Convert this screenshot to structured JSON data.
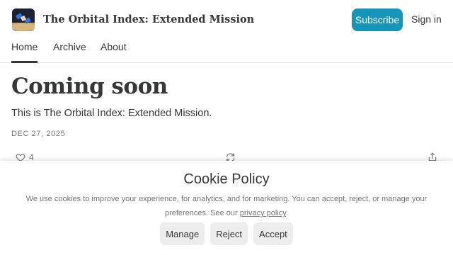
{
  "header": {
    "publication_title": "The Orbital Index: Extended Mission",
    "subscribe_label": "Subscribe",
    "signin_label": "Sign in",
    "logo_icon": "satellite-logo"
  },
  "nav": {
    "tabs": [
      {
        "label": "Home",
        "active": true
      },
      {
        "label": "Archive",
        "active": false
      },
      {
        "label": "About",
        "active": false
      }
    ]
  },
  "post": {
    "title": "Coming soon",
    "subtitle": "This is The Orbital Index: Extended Mission.",
    "date": "DEC 27, 2025",
    "like_count": "4",
    "like_icon": "heart-icon",
    "restack_icon": "restack-icon",
    "share_icon": "share-icon"
  },
  "cookie": {
    "title": "Cookie Policy",
    "text_before_link": "We use cookies to improve your experience, for analytics, and for marketing. You can accept, reject, or manage your preferences. See our ",
    "link_label": "privacy policy",
    "text_after_link": ".",
    "buttons": {
      "manage": "Manage",
      "reject": "Reject",
      "accept": "Accept"
    }
  },
  "colors": {
    "accent": "#1596b8",
    "text": "#363737",
    "muted": "#757575",
    "button_bg": "#ededed"
  }
}
